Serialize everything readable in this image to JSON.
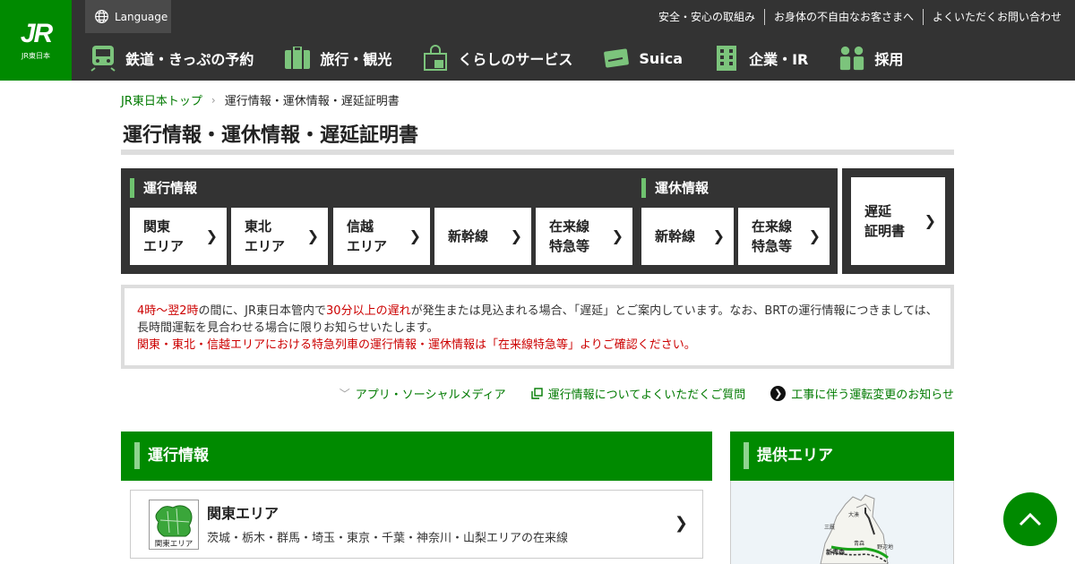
{
  "header": {
    "logo_mark": "JR",
    "logo_sub": "JR東日本",
    "language": "Language",
    "util_links": [
      "安全・安心の取組み",
      "お身体の不自由なお客さまへ",
      "よくいただくお問い合わせ"
    ],
    "nav": [
      "鉄道・きっぷの予約",
      "旅行・観光",
      "くらしのサービス",
      "Suica",
      "企業・IR",
      "採用"
    ]
  },
  "breadcrumb": {
    "home": "JR東日本トップ",
    "current": "運行情報・運休情報・遅延証明書"
  },
  "page_title": "運行情報・運休情報・遅延証明書",
  "operation": {
    "label": "運行情報",
    "tiles": [
      {
        "l1": "関東",
        "l2": "エリア"
      },
      {
        "l1": "東北",
        "l2": "エリア"
      },
      {
        "l1": "信越",
        "l2": "エリア"
      },
      {
        "l1": "新幹線",
        "l2": ""
      },
      {
        "l1": "在来線",
        "l2": "特急等"
      }
    ]
  },
  "suspension": {
    "label": "運休情報",
    "tiles": [
      {
        "l1": "新幹線",
        "l2": ""
      },
      {
        "l1": "在来線",
        "l2": "特急等"
      }
    ]
  },
  "delay": {
    "l1": "遅延",
    "l2": "証明書"
  },
  "notice": {
    "p1_red1": "4時～翌2時",
    "p1_a": "の間に、JR東日本管内で",
    "p1_red2": "30分以上の遅れ",
    "p1_b": "が発生または見込まれる場合、「遅延」とご案内しています。なお、BRTの運行情報につきましては、長時間運転を見合わせる場合に限りお知らせいたします。",
    "p2": "関東・東北・信越エリアにおける特急列車の運行情報・運休情報は「在来線特急等」よりご確認ください。"
  },
  "links": [
    "アプリ・ソーシャルメディア",
    "運行情報についてよくいただくご質問",
    "工事に伴う運転変更のお知らせ"
  ],
  "sections": {
    "left_title": "運行情報",
    "right_title": "提供エリア",
    "area_card": {
      "title": "関東エリア",
      "desc": "茨城・栃木・群馬・埼玉・東京・千葉・神奈川・山梨エリアの在来線",
      "thumb_label": "関東エリア"
    },
    "map_labels": [
      "大湊",
      "三厩",
      "青森",
      "野辺地",
      "新青森"
    ]
  },
  "colors": {
    "brand_green": "#008a00",
    "header_dark": "#333333",
    "notice_red": "#cc0000"
  }
}
